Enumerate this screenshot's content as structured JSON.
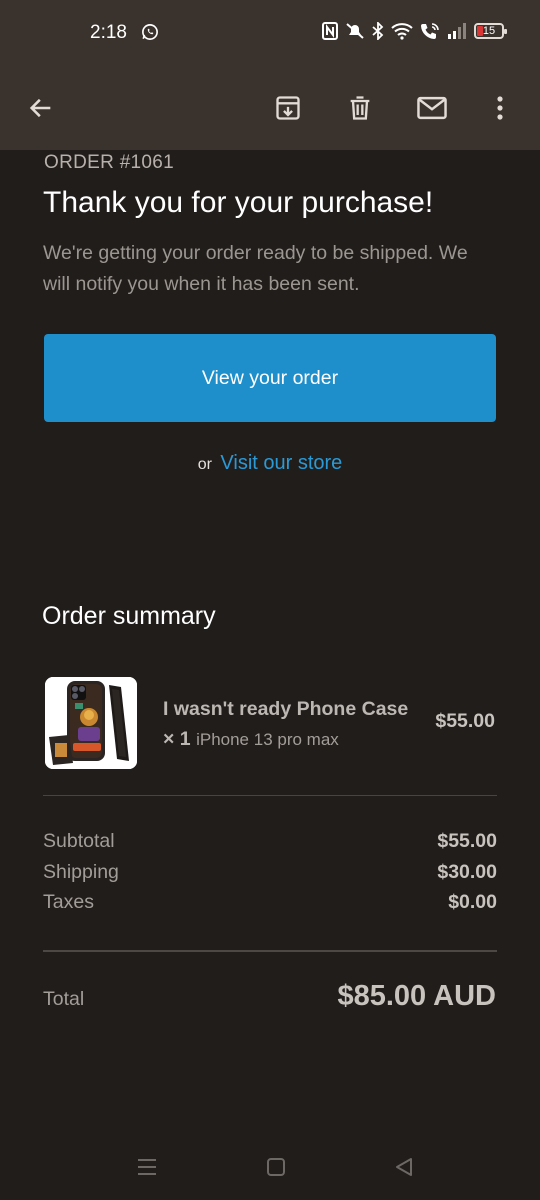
{
  "status_bar": {
    "time": "2:18",
    "battery": "15",
    "icons": [
      "whatsapp-icon",
      "nfc-icon",
      "silent-icon",
      "bluetooth-icon",
      "wifi-icon",
      "wifi-call-icon",
      "signal-icon",
      "battery-icon"
    ]
  },
  "toolbar": {
    "icons": [
      "back-arrow-icon",
      "archive-icon",
      "delete-icon",
      "mark-unread-icon",
      "more-options-icon"
    ]
  },
  "email": {
    "order_number": "ORDER #1061",
    "heading": "Thank you for your purchase!",
    "description": "We're getting your order ready to be shipped. We will notify you when it has been sent.",
    "view_order_label": "View your order",
    "or_text": "or",
    "visit_store_label": "Visit our store",
    "accent_color": "#1e8fcb"
  },
  "summary": {
    "title": "Order summary",
    "item": {
      "name": "I wasn't ready Phone Case × 1",
      "variant": "iPhone 13 pro max",
      "price": "$55.00"
    },
    "subtotal_label": "Subtotal",
    "subtotal_value": "$55.00",
    "shipping_label": "Shipping",
    "shipping_value": "$30.00",
    "taxes_label": "Taxes",
    "taxes_value": "$0.00",
    "total_label": "Total",
    "total_value": "$85.00 AUD"
  },
  "nav_bar": {
    "icons": [
      "recents-icon",
      "home-icon",
      "back-icon"
    ]
  }
}
